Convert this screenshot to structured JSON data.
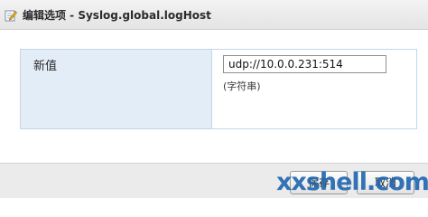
{
  "dialog": {
    "title": "编辑选项 - Syslog.global.logHost",
    "title_icon": "edit-pencil-icon"
  },
  "property": {
    "label": "新值",
    "value": "udp://10.0.0.231:514",
    "type_hint": "(字符串)"
  },
  "buttons": {
    "save_label": "保存",
    "cancel_label": "取消"
  },
  "watermark": {
    "text": "xxshell.com"
  }
}
